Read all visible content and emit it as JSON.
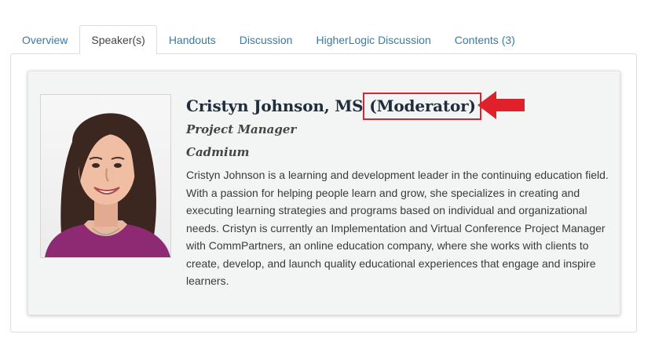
{
  "tabs": [
    {
      "label": "Overview",
      "active": false
    },
    {
      "label": "Speaker(s)",
      "active": true
    },
    {
      "label": "Handouts",
      "active": false
    },
    {
      "label": "Discussion",
      "active": false
    },
    {
      "label": "HigherLogic Discussion",
      "active": false
    },
    {
      "label": "Contents (3)",
      "active": false
    }
  ],
  "speaker": {
    "name": "Cristyn Johnson, MS",
    "role": "(Moderator)",
    "title": "Project Manager",
    "organization": "Cadmium",
    "bio": "Cristyn Johnson is a learning and development leader in the continuing education field. With a passion for helping people learn and grow, she specializes in creating and executing learning strategies and programs based on individual and organizational needs. Cristyn is currently an Implementation and Virtual Conference Project Manager with CommPartners, an online education company, where she works with clients to create, develop, and launch quality educational experiences that engage and inspire learners."
  },
  "annotations": {
    "highlight_color": "#e0202a",
    "arrow_icon": "left-arrow-icon"
  },
  "colors": {
    "tab_link": "#3a7aa3",
    "heading": "#1f2d3d",
    "card_background": "#f3f4f4"
  }
}
